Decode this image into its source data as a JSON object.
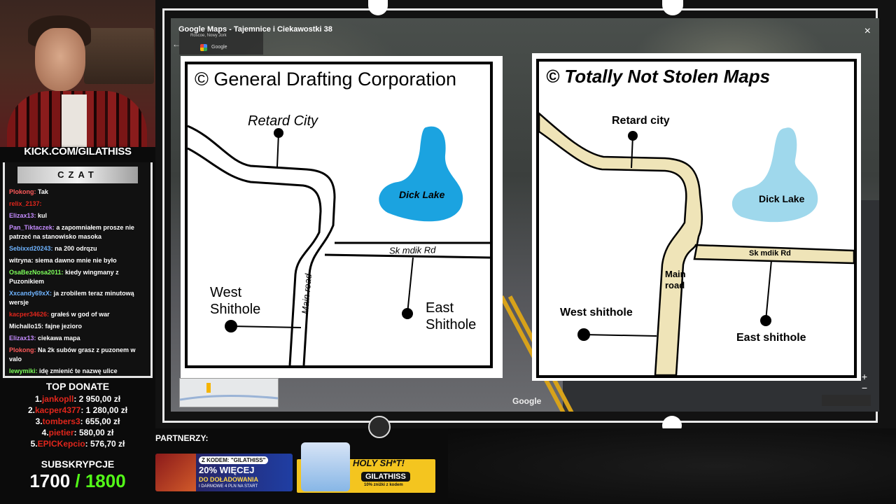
{
  "window": {
    "title": "Google Maps - Tajemnice i Ciekawostki 38",
    "close": "×",
    "location_card": {
      "address": "Roscoe, Nowy Jork",
      "provider": "Google"
    },
    "watermark": "Google",
    "zoom_in": "+",
    "zoom_out": "−"
  },
  "map1": {
    "title": "© General Drafting Corporation",
    "labels": {
      "retard_city": "Retard  City",
      "dick_lake": "Dick Lake",
      "sk_mdik_rd": "Sk mdik Rd",
      "main_road": "Main road",
      "west": "West\nShithole",
      "east": "East\nShithole"
    }
  },
  "map2": {
    "title": "© Totally Not Stolen Maps",
    "labels": {
      "retard_city": "Retard city",
      "dick_lake": "Dick Lake",
      "sk_mdik_rd": "Sk mdik Rd",
      "main_road": "Main\nroad",
      "west": "West shithole",
      "east": "East shithole"
    }
  },
  "stream": {
    "channel": "KICK.COM/GILATHISS",
    "chat_title": "CZAT",
    "chat": [
      {
        "user": "Plokong:",
        "text": "Tak",
        "color": "#ff5a5a"
      },
      {
        "user": "relix_2137:",
        "text": "",
        "color": "#e0261c"
      },
      {
        "user": "Elizax13:",
        "text": "kul",
        "color": "#c58cff"
      },
      {
        "user": "Pan_Tiktaczek:",
        "text": "a zapomniałem prosze nie patrzeć na stanowisko masoka",
        "color": "#c58cff"
      },
      {
        "user": "Sebixxd20243:",
        "text": "na 200 odrqzu",
        "color": "#6fb4ff"
      },
      {
        "user": "witryna:",
        "text": "siema dawno mnie nie było",
        "color": "#ffffff"
      },
      {
        "user": "OsaBezNosa2011:",
        "text": "kiedy wingmany z Puzonikiem",
        "color": "#7dff5a"
      },
      {
        "user": "Xxcandy69xX:",
        "text": "ja zrobilem teraz minutową wersje",
        "color": "#6fb4ff"
      },
      {
        "user": "kacper34626:",
        "text": "grałeś w god of war",
        "color": "#e0261c"
      },
      {
        "user": "Michallo15:",
        "text": "fajne jezioro",
        "color": "#ffffff"
      },
      {
        "user": "Elizax13:",
        "text": "ciekawa mapa",
        "color": "#c58cff"
      },
      {
        "user": "Plokong:",
        "text": "Na 2k subów grasz z puzonem w valo",
        "color": "#ff5a5a"
      },
      {
        "user": "lewymiki:",
        "text": "idę zmienić te nazwę ulice",
        "color": "#7dff5a"
      }
    ],
    "top_donate_title": "TOP DONATE",
    "donations": [
      {
        "rank": "1.",
        "name": "jankopll",
        "amount": ": 2 950,00 zł"
      },
      {
        "rank": "2.",
        "name": "kacper4377",
        "amount": ": 1 280,00 zł"
      },
      {
        "rank": "3.",
        "name": "tombers3",
        "amount": ": 655,00 zł"
      },
      {
        "rank": "4.",
        "name": "pietier",
        "amount": ": 580,00 zł"
      },
      {
        "rank": "5.",
        "name": "EPICKepcio",
        "amount": ": 576,70 zł"
      }
    ],
    "subs_title": "SUBSKRYPCJE",
    "subs_current": "1700",
    "subs_goal": "/ 1800",
    "partners_title": "PARTNERZY:",
    "banner1": {
      "code": "Z KODEM: \"GILATHISS\"",
      "headline": "20% WIĘCEJ",
      "sub": "DO DOŁADOWANIA",
      "small": "I DARMOWE 4 PLN NA START"
    },
    "banner2": {
      "headline": "HOLY SH*T!",
      "code": "GILATHISS",
      "small": "10% zniżki z kodem"
    }
  }
}
